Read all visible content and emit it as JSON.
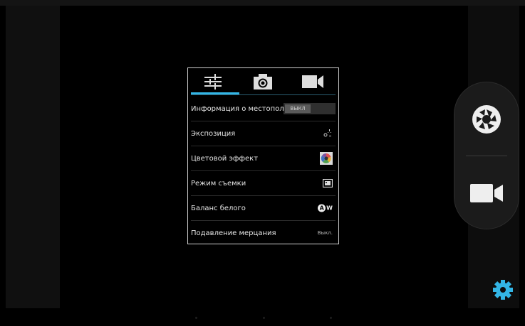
{
  "settings_panel": {
    "tabs": [
      {
        "icon": "sliders-icon"
      },
      {
        "icon": "camera-icon"
      },
      {
        "icon": "video-camera-icon"
      }
    ],
    "rows": [
      {
        "label": "Информация о местопол",
        "toggle_text": "ВЫКЛ",
        "icon": "toggle-switch"
      },
      {
        "label": "Экспозиция",
        "icon": "exposure-icon"
      },
      {
        "label": "Цветовой эффект",
        "icon": "color-effect-icon"
      },
      {
        "label": "Режим съемки",
        "icon": "scene-mode-icon"
      },
      {
        "label": "Баланс белого",
        "icon": "auto-white-balance-icon",
        "icon_text": "A",
        "icon_suffix": "W"
      },
      {
        "label": "Подавление мерцания",
        "value": "Выкл."
      }
    ]
  },
  "controls": {
    "shutter": {
      "icon": "shutter-icon"
    },
    "video": {
      "icon": "video-camera-icon"
    },
    "settings": {
      "icon": "gear-icon"
    }
  },
  "colors": {
    "accent": "#33b5e5",
    "gear": "#33b5e5",
    "panel_border": "#cfcfcf"
  }
}
